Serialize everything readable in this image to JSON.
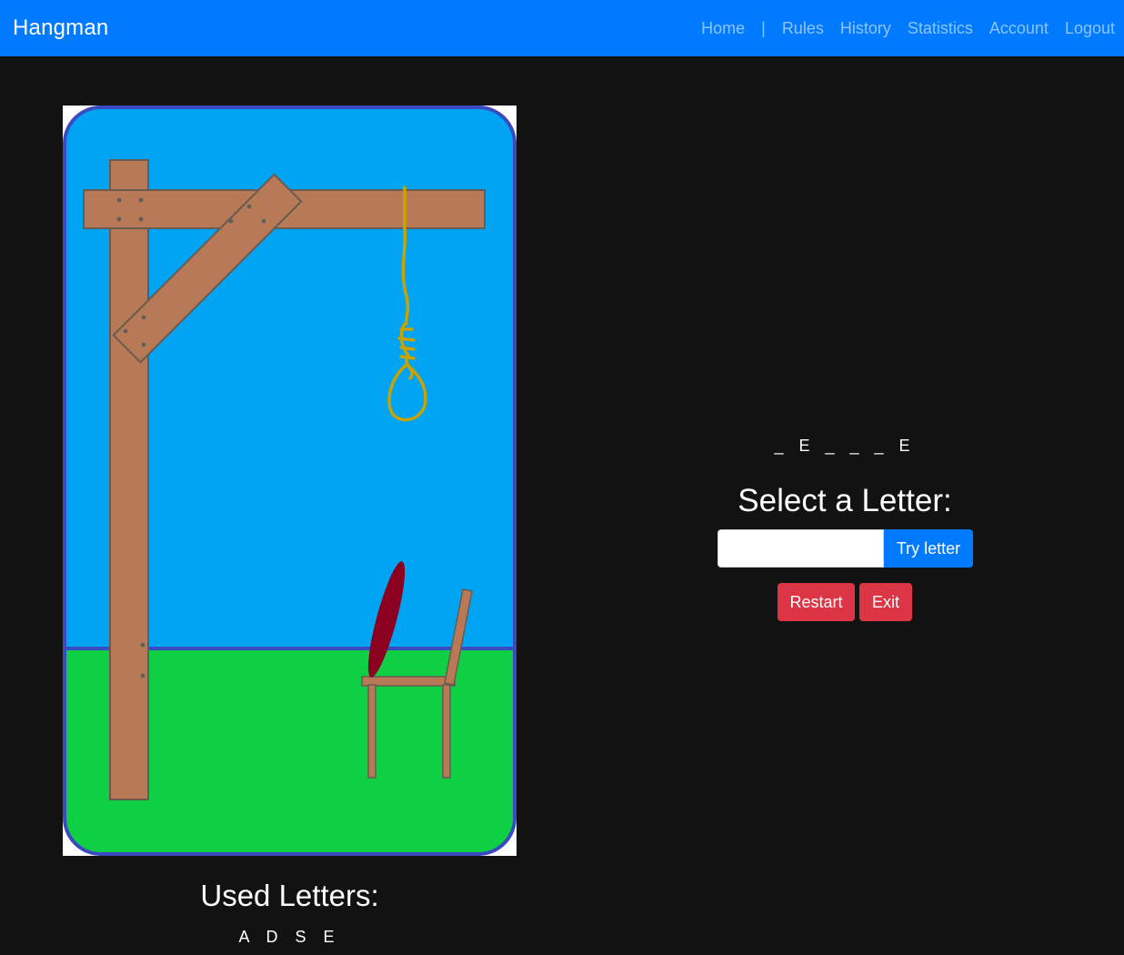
{
  "navbar": {
    "brand": "Hangman",
    "links": [
      "Home",
      "|",
      "Rules",
      "History",
      "Statistics",
      "Account",
      "Logout"
    ]
  },
  "colors": {
    "navbar": "#007bff",
    "background": "#121212",
    "danger": "#dc3545",
    "sky": "#00a4f2",
    "grass": "#0fd045",
    "wood": "#b87a56",
    "rope": "#c8a200",
    "figure": "#8b0020"
  },
  "image": {
    "alt": "hangman-stage-image",
    "elements": [
      "sky",
      "grass",
      "gallows",
      "noose",
      "chair",
      "body-part"
    ]
  },
  "game": {
    "word_display": "_ E _ _ _ E",
    "select_title": "Select a Letter:",
    "input_value": "",
    "try_button": "Try letter",
    "restart_button": "Restart",
    "exit_button": "Exit",
    "used_title": "Used Letters:",
    "used_letters": "A D S E"
  }
}
